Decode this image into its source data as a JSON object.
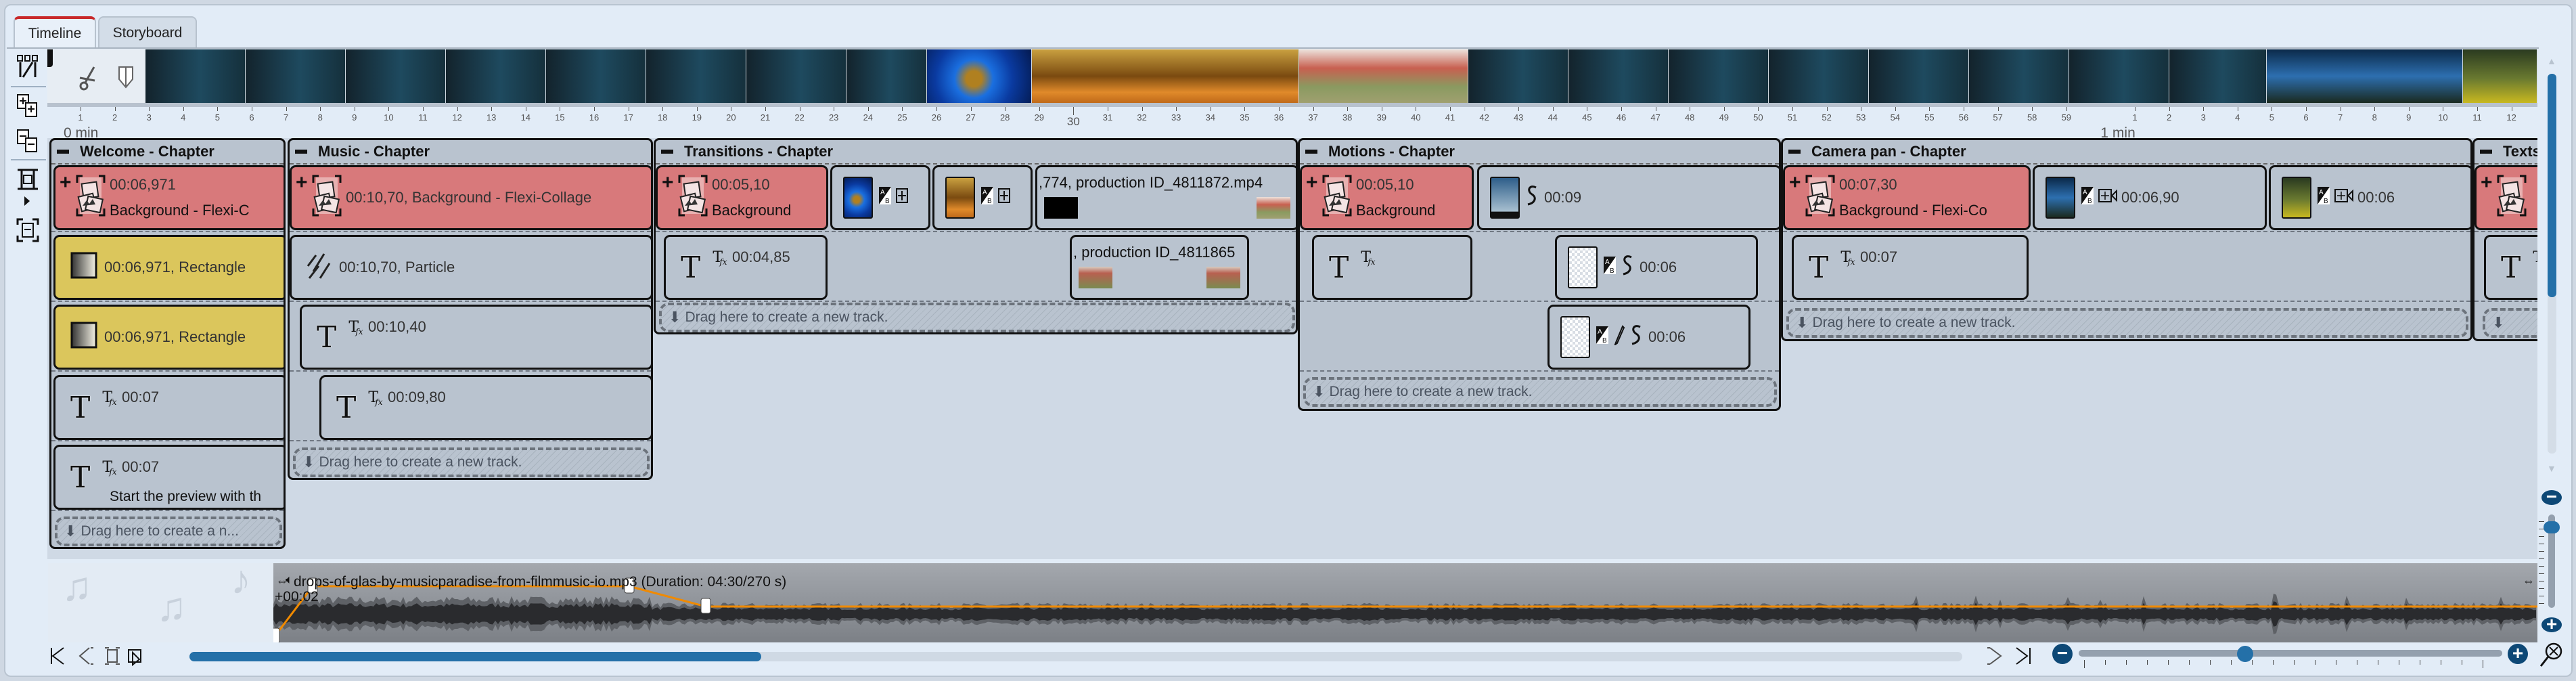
{
  "tabs": [
    {
      "label": "Timeline",
      "active": true
    },
    {
      "label": "Storyboard",
      "active": false
    }
  ],
  "toolbar_icons": [
    "split-tracks-icon",
    "expand-all-icon",
    "collapse-all-icon",
    "fit-height-icon",
    "fit-all-icon"
  ],
  "strip_tools": [
    "scissors-icon",
    "marker-icon"
  ],
  "thumbnail_strip": [
    "dark-teal",
    "blue-flower",
    "autumn-forest",
    "poppies",
    "dark-teal",
    "blue-butterflies",
    "green-forest"
  ],
  "ruler": {
    "zero_label": "0 min",
    "minute_label": "1 min",
    "thirty_label": "30",
    "seconds_first_minute": 59,
    "seconds_second_minute": 12
  },
  "colors": {
    "background_clip": "#d8797b",
    "shape_clip": "#dbc65c",
    "accent": "#2470a8",
    "volume_line": "#f08a00",
    "chapter": "#b9c3cf"
  },
  "chapters": [
    {
      "title": "Welcome - Chapter",
      "drag_label": "Drag here to create a n...",
      "clips": [
        {
          "type": "collage",
          "color": "red",
          "lines": [
            "00:06,971",
            "Background - Flexi-C"
          ]
        },
        {
          "type": "rectangle",
          "color": "yellow",
          "lines": [
            "00:06,971, Rectangle"
          ]
        },
        {
          "type": "rectangle",
          "color": "yellow",
          "lines": [
            "00:06,971, Rectangle"
          ]
        },
        {
          "type": "text",
          "lines": [
            "00:07"
          ]
        },
        {
          "type": "text",
          "lines": [
            "00:07"
          ],
          "caption": "Start the preview with th"
        }
      ]
    },
    {
      "title": "Music - Chapter",
      "drag_label": "Drag here to create a new track.",
      "clips": [
        {
          "type": "collage",
          "color": "red",
          "lines": [
            "00:10,70, Background - Flexi-Collage"
          ]
        },
        {
          "type": "particle",
          "lines": [
            "00:10,70, Particle"
          ]
        },
        {
          "type": "text",
          "lines": [
            "00:10,40"
          ]
        },
        {
          "type": "text",
          "lines": [
            "00:09,80"
          ]
        }
      ]
    },
    {
      "title": "Transitions - Chapter",
      "drag_label": "Drag here to create a new track.",
      "clips": [
        {
          "type": "collage",
          "color": "red",
          "lines": [
            "00:05,10",
            "Background"
          ]
        },
        {
          "type": "image",
          "thumb": "blue-flower",
          "icons": [
            "transition-ab-icon",
            "pan-icon"
          ],
          "lines": []
        },
        {
          "type": "image",
          "thumb": "autumn-forest",
          "icons": [
            "transition-ab-icon",
            "pan-icon"
          ],
          "lines": []
        },
        {
          "type": "video",
          "lines": [
            ",774, production ID_4811872.mp4"
          ],
          "thumbs": [
            "black",
            "poppies"
          ]
        },
        {
          "type": "text",
          "lines": [
            "00:04,85"
          ]
        },
        {
          "type": "video",
          "lines": [
            ", production ID_4811865"
          ],
          "thumbs": [
            "girl-in-poppies",
            "girl-in-poppies"
          ]
        }
      ]
    },
    {
      "title": "Motions - Chapter",
      "drag_label": "Drag here to create a new track.",
      "clips": [
        {
          "type": "collage",
          "color": "red",
          "lines": [
            "00:05,10",
            "Background"
          ]
        },
        {
          "type": "image",
          "thumb": "sky",
          "icons": [
            "motion-path-icon"
          ],
          "lines": [
            "00:09"
          ]
        },
        {
          "type": "text",
          "lines": []
        },
        {
          "type": "image",
          "thumb": "transparent",
          "icons": [
            "transition-ab-icon",
            "motion-path-icon"
          ],
          "lines": [
            "00:06"
          ]
        },
        {
          "type": "image",
          "thumb": "transparent",
          "icons": [
            "transition-ab-icon",
            "pencil-icon",
            "motion-path-icon"
          ],
          "lines": [
            "00:06"
          ]
        }
      ]
    },
    {
      "title": "Camera pan - Chapter",
      "drag_label": "Drag here to create a new track.",
      "clips": [
        {
          "type": "collage",
          "color": "red",
          "lines": [
            "00:07,30",
            "Background - Flexi-Co"
          ]
        },
        {
          "type": "image",
          "thumb": "blue-butterflies",
          "icons": [
            "transition-ab-icon",
            "camera-pan-icon"
          ],
          "lines": [
            "00:06,90"
          ]
        },
        {
          "type": "image",
          "thumb": "green-forest",
          "icons": [
            "transition-ab-icon",
            "camera-pan-icon"
          ],
          "lines": [
            "00:06"
          ]
        },
        {
          "type": "text",
          "lines": [
            "00:07"
          ]
        }
      ]
    },
    {
      "title": "Texts",
      "drag_label": "",
      "clips": [
        {
          "type": "collage",
          "color": "red",
          "lines": []
        },
        {
          "type": "text",
          "lines": []
        }
      ]
    }
  ],
  "audio": {
    "title": "drops-of-glas-by-musicparadise-from-filmmusic-io.mp3 (Duration: 04:30/270 s)",
    "offset": "+00:02"
  },
  "scroll": {
    "horizontal_position_percent": 32,
    "vertical_position_percent": 0,
    "zoom_level_percent": 40
  }
}
